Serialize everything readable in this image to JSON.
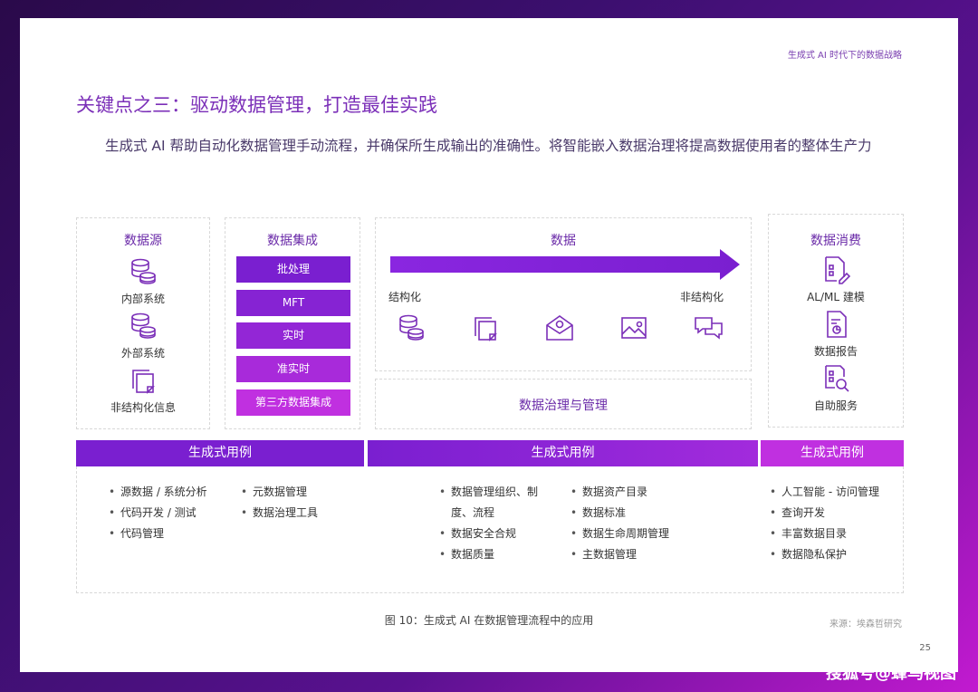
{
  "header": {
    "runner": "生成式 AI 时代下的数据战略"
  },
  "heading": "关键点之三：驱动数据管理，打造最佳实践",
  "intro": "生成式 AI 帮助自动化数据管理手动流程，并确保所生成输出的准确性。将智能嵌入数据治理将提高数据使用者的整体生产力",
  "diagram": {
    "sources": {
      "title": "数据源",
      "items": [
        {
          "label": "内部系统",
          "icon": "database-icon"
        },
        {
          "label": "外部系统",
          "icon": "database-icon"
        },
        {
          "label": "非结构化信息",
          "icon": "documents-icon"
        }
      ]
    },
    "integration": {
      "title": "数据集成",
      "items": [
        "批处理",
        "MFT",
        "实时",
        "准实时",
        "第三方数据集成"
      ]
    },
    "data": {
      "title": "数据",
      "left_label": "结构化",
      "right_label": "非结构化",
      "icons": [
        "database-icon",
        "documents-icon",
        "email-icon",
        "image-icon",
        "chat-icon"
      ],
      "governance": "数据治理与管理"
    },
    "consumption": {
      "title": "数据消费",
      "items": [
        {
          "label": "AL/ML 建模",
          "icon": "ml-document-icon"
        },
        {
          "label": "数据报告",
          "icon": "report-icon"
        },
        {
          "label": "自助服务",
          "icon": "self-service-icon"
        }
      ]
    },
    "usecases": [
      {
        "title": "生成式用例",
        "col1": [
          "源数据 / 系统分析",
          "代码开发 / 测试",
          "代码管理"
        ],
        "col2": [
          "元数据管理",
          "数据治理工具"
        ]
      },
      {
        "title": "生成式用例",
        "col1": [
          "数据管理组织、制度、流程",
          "数据安全合规",
          "数据质量"
        ],
        "col2": [
          "数据资产目录",
          "数据标准",
          "数据生命周期管理",
          "主数据管理"
        ]
      },
      {
        "title": "生成式用例",
        "col1": [
          "人工智能 - 访问管理",
          "查询开发",
          "丰富数据目录",
          "数据隐私保护"
        ],
        "col2": []
      }
    ]
  },
  "caption": "图 10：生成式 AI 在数据管理流程中的应用",
  "source": "来源：埃森哲研究",
  "page_number": "25",
  "watermark": "搜狐号@蜂鸟视图",
  "colors": {
    "accent": "#7b2fb8",
    "bar_dark": "#7a1fd0",
    "bar_light": "#c030e0"
  }
}
